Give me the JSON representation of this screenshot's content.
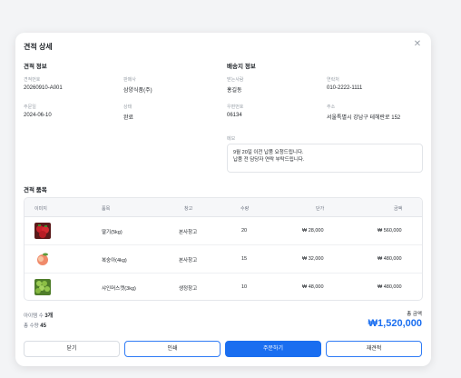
{
  "modal": {
    "title": "견적 상세",
    "close_icon": "close-icon"
  },
  "quote_info": {
    "section_title": "견적 정보",
    "number_label": "견적번호",
    "number": "20260910-A001",
    "seller_label": "판매사",
    "seller": "삼양식품(주)",
    "date_label": "주문일",
    "date": "2024-06-10",
    "status_label": "상태",
    "status": "완료"
  },
  "shipping_info": {
    "section_title": "배송지 정보",
    "recipient_label": "받는사람",
    "recipient": "홍길동",
    "phone_label": "연락처",
    "phone": "010-2222-1111",
    "postcode_label": "우편번호",
    "postcode": "06134",
    "address_label": "주소",
    "address": "서울특별시 강남구 테헤란로 152",
    "memo_label": "메모",
    "memo_line1": "9월 20일 이전 납품 요청드립니다.",
    "memo_line2": "납품 전 담당자 연락 부탁드립니다."
  },
  "items": {
    "section_title": "견적 품목",
    "headers": {
      "image": "이미지",
      "name": "품목",
      "warehouse": "창고",
      "qty": "수량",
      "unit_price": "단가",
      "amount": "금액"
    },
    "rows": [
      {
        "name": "딸기(5kg)",
        "warehouse": "본사창고",
        "qty": "20",
        "unit_price": "₩ 28,000",
        "amount": "₩ 560,000",
        "thumb": "strawberry"
      },
      {
        "name": "복숭아(4kg)",
        "warehouse": "본사창고",
        "qty": "15",
        "unit_price": "₩ 32,000",
        "amount": "₩ 480,000",
        "thumb": "peach"
      },
      {
        "name": "샤인머스캣(3kg)",
        "warehouse": "생정창고",
        "qty": "10",
        "unit_price": "₩ 48,000",
        "amount": "₩ 480,000",
        "thumb": "grape"
      }
    ]
  },
  "summary": {
    "item_count_label": "아이템 수",
    "item_count": "3개",
    "total_qty_label": "총 수량",
    "total_qty": "45",
    "total_label": "총 금액",
    "total_value": "₩1,520,000"
  },
  "buttons": {
    "close": "닫기",
    "print": "인쇄",
    "order": "주문하기",
    "requote": "재견적"
  },
  "colors": {
    "accent": "#1a6ef0"
  }
}
